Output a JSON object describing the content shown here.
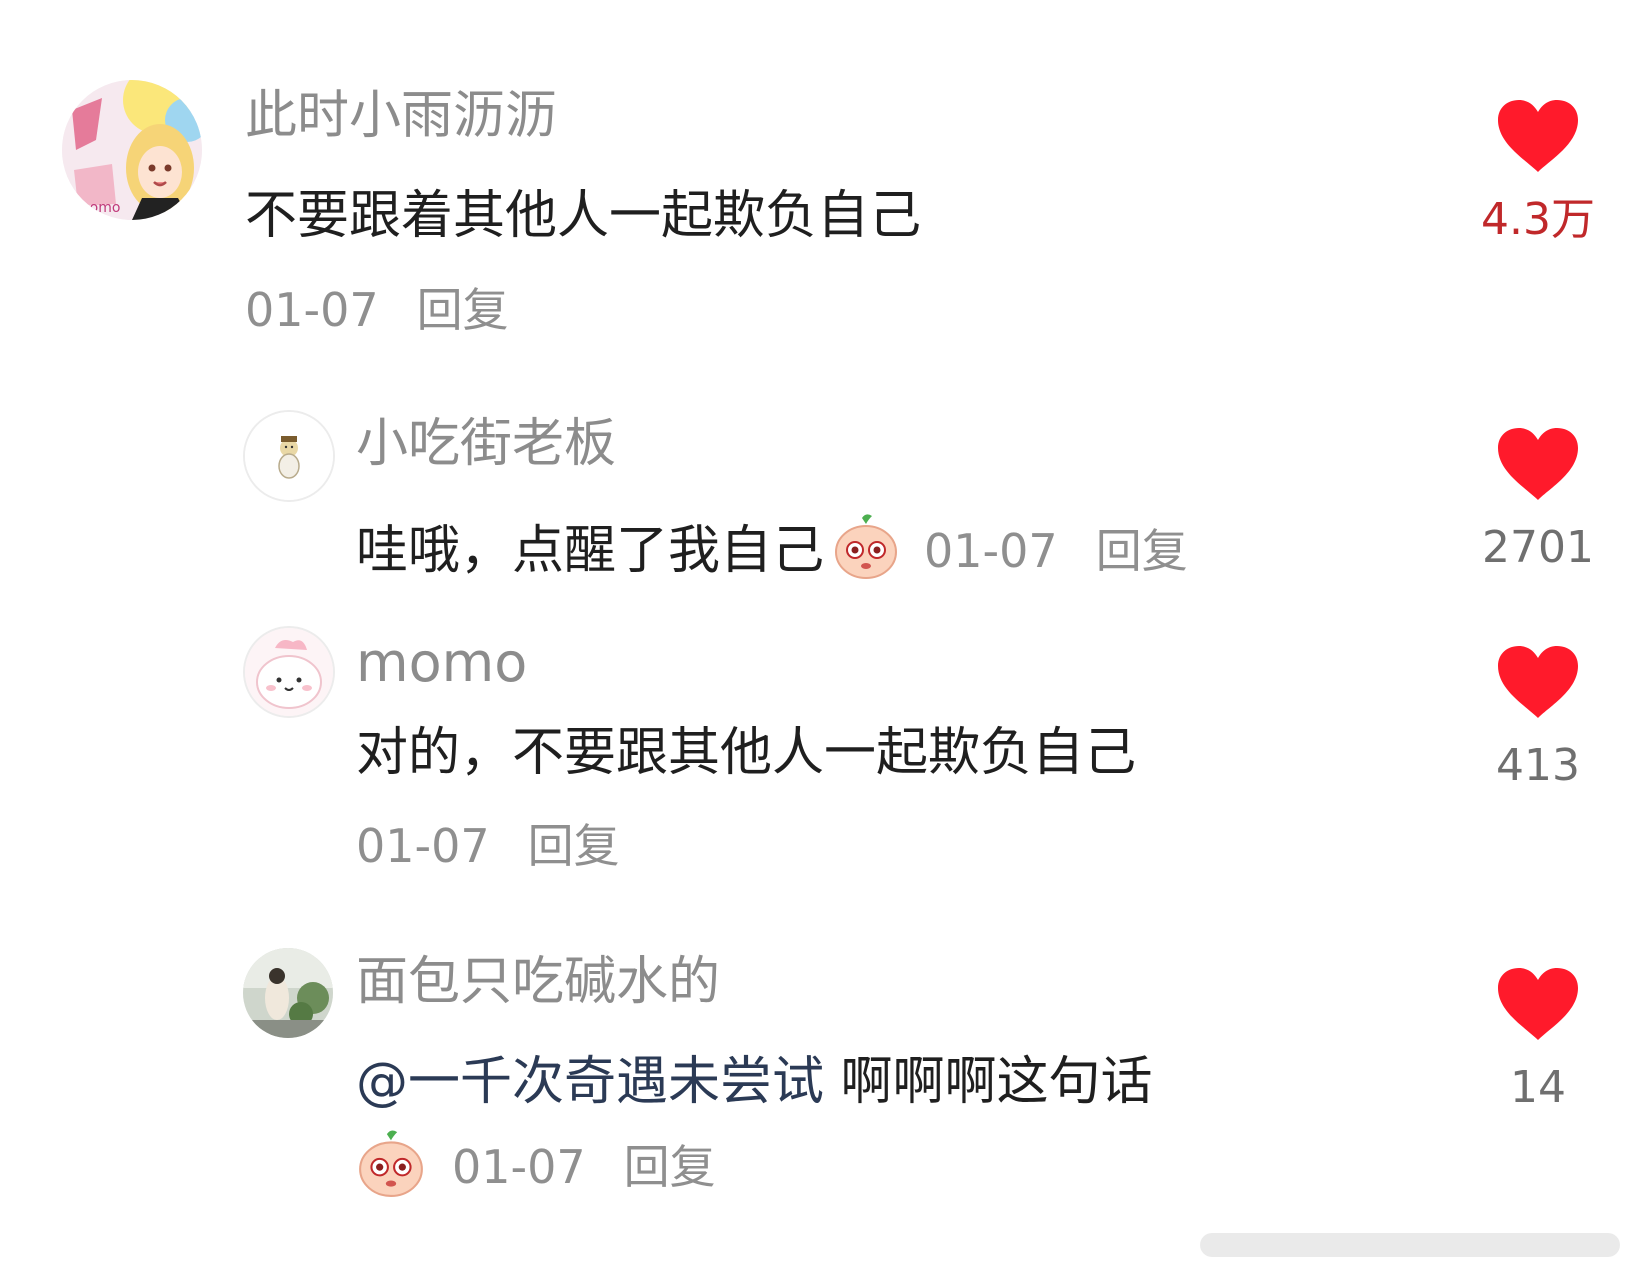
{
  "comments": [
    {
      "username": "此时小雨沥沥",
      "text": "不要跟着其他人一起欺负自己",
      "date": "01-07",
      "reply": "回复",
      "likes": "4.3万"
    },
    {
      "username": "小吃街老板",
      "text": "哇哦，点醒了我自己",
      "emoji": "peach-face-emoji",
      "date": "01-07",
      "reply": "回复",
      "likes": "2701"
    },
    {
      "username": "momo",
      "text": "对的，不要跟其他人一起欺负自己",
      "date": "01-07",
      "reply": "回复",
      "likes": "413"
    },
    {
      "username": "面包只吃碱水的",
      "mention": "@一千次奇遇未尝试",
      "text": " 啊啊啊这句话",
      "emoji": "peach-face-emoji",
      "date": "01-07",
      "reply": "回复",
      "likes": "14"
    }
  ],
  "colors": {
    "heart": "#ff1a2b",
    "hot_count": "#c0282a",
    "username": "#8c8c8c",
    "text": "#1f1f1f"
  },
  "icons": [
    "heart-icon",
    "peach-face-emoji"
  ]
}
